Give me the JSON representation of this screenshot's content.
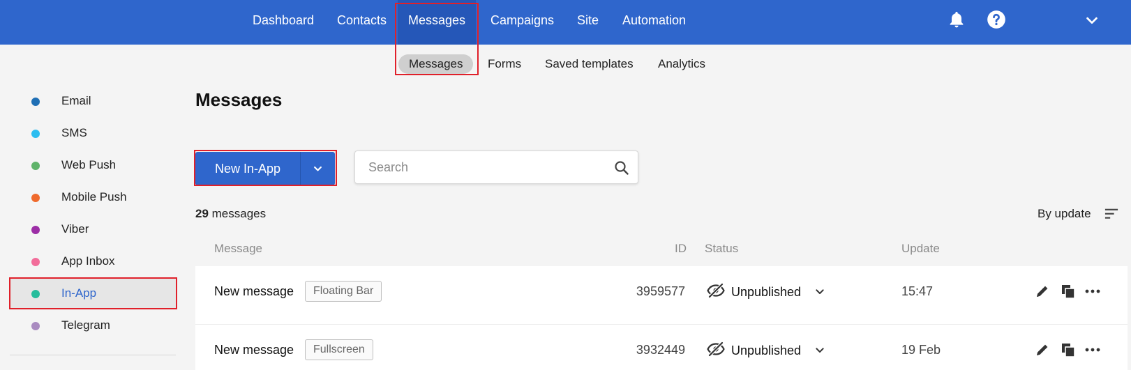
{
  "topnav": {
    "items": [
      {
        "label": "Dashboard"
      },
      {
        "label": "Contacts"
      },
      {
        "label": "Messages"
      },
      {
        "label": "Campaigns"
      },
      {
        "label": "Site"
      },
      {
        "label": "Automation"
      }
    ],
    "active": "Messages",
    "icons": [
      "bell-icon",
      "help-icon",
      "chevron-down-icon"
    ]
  },
  "subnav": {
    "items": [
      {
        "label": "Messages"
      },
      {
        "label": "Forms"
      },
      {
        "label": "Saved templates"
      },
      {
        "label": "Analytics"
      }
    ],
    "active": "Messages"
  },
  "sidebar": {
    "items": [
      {
        "label": "Email",
        "color": "#1f6fb5"
      },
      {
        "label": "SMS",
        "color": "#2bbdf0"
      },
      {
        "label": "Web Push",
        "color": "#5fb36a"
      },
      {
        "label": "Mobile Push",
        "color": "#ef6a2c"
      },
      {
        "label": "Viber",
        "color": "#9c2ea6"
      },
      {
        "label": "App Inbox",
        "color": "#f26d9a"
      },
      {
        "label": "In-App",
        "color": "#26bd9c"
      },
      {
        "label": "Telegram",
        "color": "#a98bc0"
      }
    ],
    "active": "In-App"
  },
  "main": {
    "title": "Messages",
    "new_button_label": "New In-App",
    "search_placeholder": "Search",
    "count": "29",
    "count_suffix": " messages",
    "sort_label": "By update",
    "columns": {
      "message": "Message",
      "id": "ID",
      "status": "Status",
      "update": "Update"
    },
    "rows": [
      {
        "name": "New message",
        "type": "Floating Bar",
        "id": "3959577",
        "status": "Unpublished",
        "update": "15:47"
      },
      {
        "name": "New message",
        "type": "Fullscreen",
        "id": "3932449",
        "status": "Unpublished",
        "update": "19 Feb"
      }
    ]
  },
  "colors": {
    "accent": "#2f66cc",
    "highlight": "#e0202a"
  }
}
